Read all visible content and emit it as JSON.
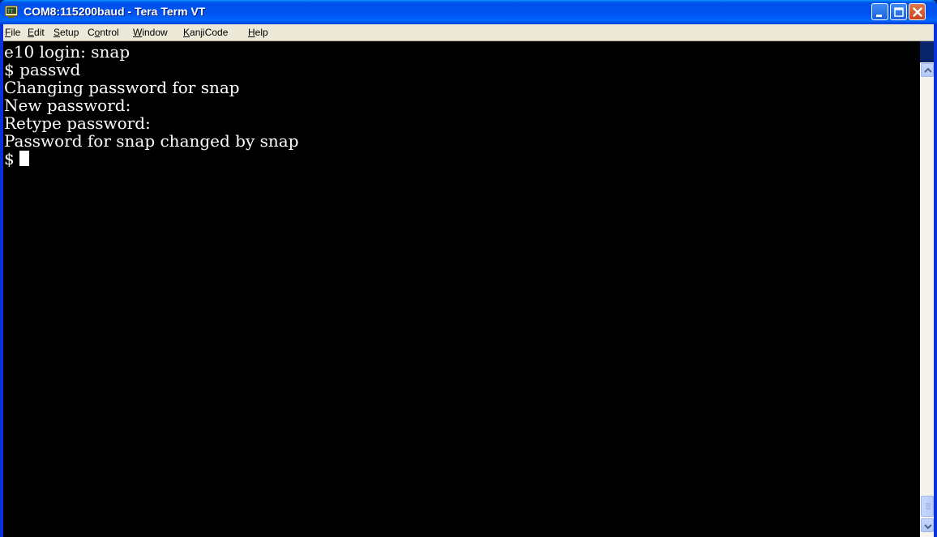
{
  "window": {
    "title": "COM8:115200baud - Tera Term VT"
  },
  "menu": [
    {
      "label": "File",
      "hotkey": "F",
      "rest": "ile"
    },
    {
      "label": "Edit",
      "hotkey": "E",
      "rest": "dit"
    },
    {
      "label": "Setup",
      "hotkey": "S",
      "rest": "etup"
    },
    {
      "label": "Control",
      "pre": "C",
      "hotkey": "o",
      "rest": "ntrol"
    },
    {
      "label": "Window",
      "hotkey": "W",
      "rest": "indow"
    },
    {
      "label": "KanjiCode",
      "hotkey": "K",
      "rest": "anjiCode"
    },
    {
      "label": "Help",
      "hotkey": "H",
      "rest": "elp"
    }
  ],
  "terminal": {
    "lines": [
      "",
      "e10 login: snap",
      "$ passwd",
      "Changing password for snap",
      "New password:",
      "Retype password:",
      "Password for snap changed by snap",
      "$ "
    ]
  },
  "colors": {
    "titlebar": "#0050ee",
    "terminal_bg": "#000000",
    "terminal_fg": "#ffffff",
    "menubar_bg": "#ece9d8"
  },
  "icons": {
    "app": "tera-term-icon",
    "minimize": "minimize-icon",
    "maximize": "maximize-icon",
    "close": "close-icon"
  }
}
